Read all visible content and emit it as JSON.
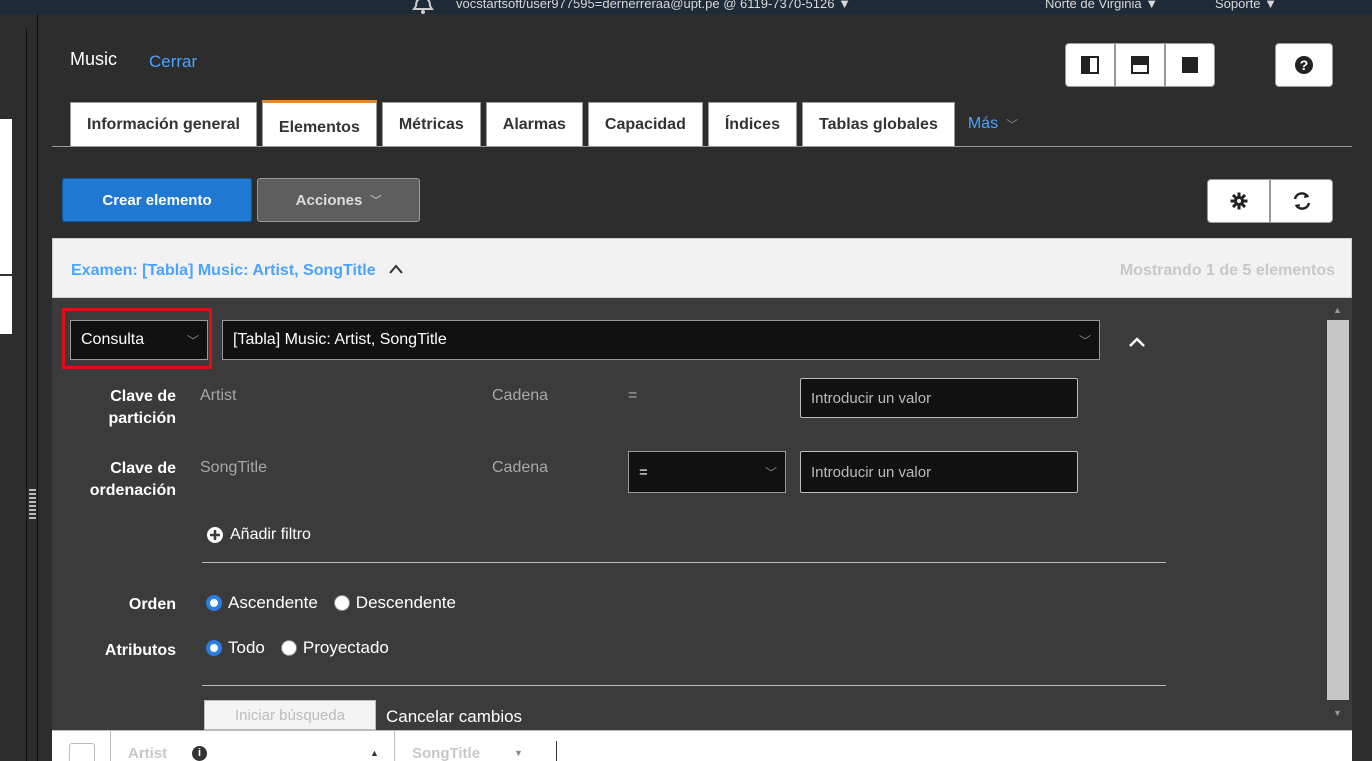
{
  "topbar": {
    "account": "vocstartsoft/user977595=dernerreraa@upt.pe @ 6119-7370-5126 ▼",
    "region": "Norte de Virginia ▼",
    "support": "Soporte ▼"
  },
  "header": {
    "table_name": "Music",
    "close_label": "Cerrar",
    "help_label": "?"
  },
  "tabs": [
    {
      "label": "Información general",
      "active": false
    },
    {
      "label": "Elementos",
      "active": true
    },
    {
      "label": "Métricas",
      "active": false
    },
    {
      "label": "Alarmas",
      "active": false
    },
    {
      "label": "Capacidad",
      "active": false
    },
    {
      "label": "Índices",
      "active": false
    },
    {
      "label": "Tablas globales",
      "active": false
    }
  ],
  "tab_more": "Más",
  "toolbar": {
    "create_label": "Crear elemento",
    "actions_label": "Acciones"
  },
  "scan": {
    "title": "Examen: [Tabla] Music: Artist, SongTitle",
    "count": "Mostrando 1 de 5 elementos"
  },
  "query": {
    "mode": "Consulta",
    "index": "[Tabla] Music: Artist, SongTitle",
    "partition": {
      "label_line1": "Clave de",
      "label_line2": "partición",
      "attribute": "Artist",
      "type": "Cadena",
      "operator": "=",
      "placeholder": "Introducir un valor"
    },
    "sort": {
      "label_line1": "Clave de",
      "label_line2": "ordenación",
      "attribute": "SongTitle",
      "type": "Cadena",
      "operator": "=",
      "placeholder": "Introducir un valor"
    },
    "add_filter": "Añadir filtro",
    "order": {
      "label": "Orden",
      "option1": "Ascendente",
      "option2": "Descendente",
      "selected": "Ascendente"
    },
    "attributes": {
      "label": "Atributos",
      "option1": "Todo",
      "option2": "Proyectado",
      "selected": "Todo"
    },
    "start_label": "Iniciar búsqueda",
    "cancel_label": "Cancelar cambios"
  },
  "table": {
    "columns": [
      "Artist",
      "SongTitle"
    ]
  },
  "colors": {
    "accent_blue": "#1f78d1",
    "link_blue": "#4aa3ff",
    "active_tab": "#e8862a",
    "highlight_red": "#e01010"
  }
}
